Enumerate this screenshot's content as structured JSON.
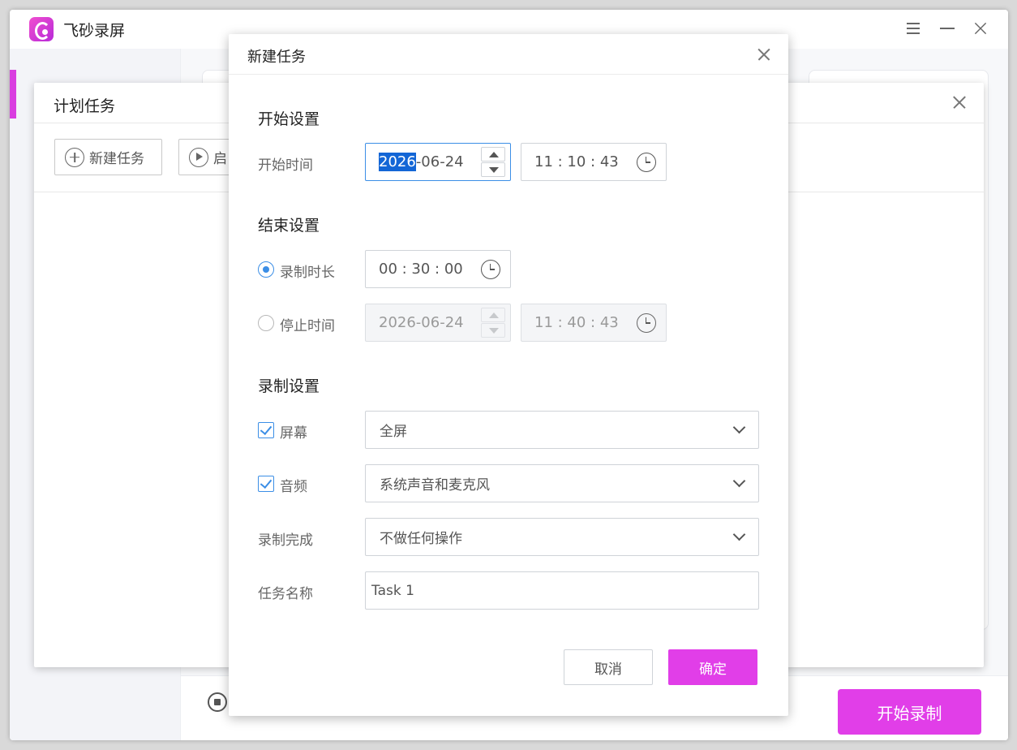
{
  "app": {
    "title": "飞砂录屏",
    "start_record_label": "开始录制"
  },
  "plan_dialog": {
    "title": "计划任务",
    "new_task_label": "新建任务",
    "start_label": "启"
  },
  "new_task_dialog": {
    "title": "新建任务",
    "start_section": {
      "title": "开始设置",
      "time_label": "开始时间",
      "date_year": "2026",
      "date_rest": "-06-24",
      "time_value": "11 : 10 : 43"
    },
    "end_section": {
      "title": "结束设置",
      "duration_label": "录制时长",
      "duration_value": "00 : 30 : 00",
      "duration_selected": true,
      "stop_time_label": "停止时间",
      "stop_date_value": "2026-06-24",
      "stop_time_value": "11 : 40 : 43"
    },
    "record_section": {
      "title": "录制设置",
      "screen_label": "屏幕",
      "screen_checked": true,
      "screen_value": "全屏",
      "audio_label": "音频",
      "audio_checked": true,
      "audio_value": "系统声音和麦克风",
      "on_complete_label": "录制完成",
      "on_complete_value": "不做任何操作",
      "task_name_label": "任务名称",
      "task_name_value": "Task 1"
    },
    "cancel_label": "取消",
    "ok_label": "确定"
  },
  "colors": {
    "accent": "#e13ee8",
    "focus_blue": "#3b8ee6",
    "selection_blue": "#1366d6"
  }
}
